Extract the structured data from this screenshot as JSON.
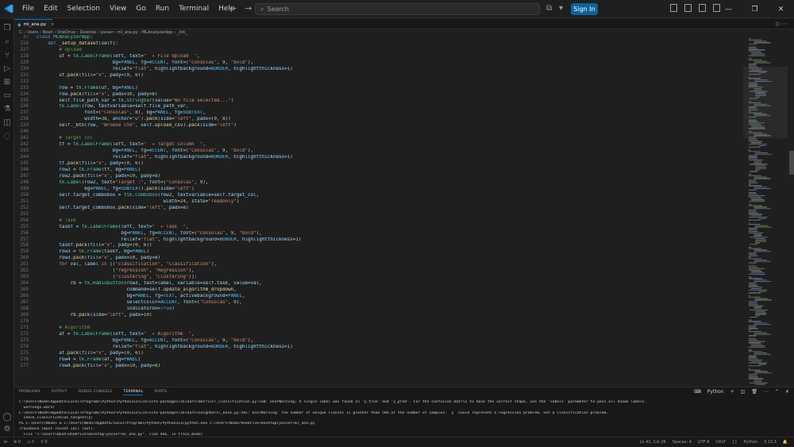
{
  "titlebar": {
    "menu": [
      "File",
      "Edit",
      "Selection",
      "View",
      "Go",
      "Run",
      "Terminal",
      "Help"
    ],
    "search_placeholder": "Search",
    "signin_label": "Sign In"
  },
  "tab": {
    "filename": "ml_ana.py",
    "close": "×"
  },
  "breadcrumb": [
    "C:",
    "Users",
    "Noah",
    "OneDrive",
    "Desktop",
    "yasser",
    "ml_ana.py",
    "MLAnalyzerApp",
    "_init_"
  ],
  "sticky_lines": [
    {
      "n": "37",
      "html": "<span class=\"kw\">class</span> <span class=\"cls\">MLAnalyzerApp</span>:"
    },
    {
      "n": "216",
      "html": "    <span class=\"kw\">def</span> <span class=\"fn\">_setup_dataset</span>(<span class=\"var\">self</span>):"
    }
  ],
  "code_lines": [
    {
      "n": "227",
      "html": "        <span class=\"cm\"># Upload</span>"
    },
    {
      "n": "228",
      "html": "        <span class=\"var\">uf</span> = <span class=\"cls\">tk</span>.<span class=\"cls\">LabelFrame</span>(<span class=\"var\">left</span>, <span class=\"var\">text</span>=<span class=\"str\">\"  ✦ File Upload  \"</span>,"
    },
    {
      "n": "229",
      "html": "                           <span class=\"var\">bg</span>=<span class=\"cst\">PANEL</span>, <span class=\"var\">fg</span>=<span class=\"cst\">ACCENT</span>, <span class=\"var\">font</span>=(<span class=\"str\">\"Consolas\"</span>, <span class=\"num\">9</span>, <span class=\"str\">\"bold\"</span>),"
    },
    {
      "n": "230",
      "html": "                           <span class=\"var\">relief</span>=<span class=\"str\">\"flat\"</span>, <span class=\"var\">highlightbackground</span>=<span class=\"cst\">BORDER</span>, <span class=\"var\">highlightthickness</span>=<span class=\"num\">1</span>)"
    },
    {
      "n": "231",
      "html": "        <span class=\"var\">uf</span>.<span class=\"fn\">pack</span>(<span class=\"var\">fill</span>=<span class=\"str\">\"x\"</span>, <span class=\"var\">pady</span>=(<span class=\"num\">0</span>, <span class=\"num\">6</span>))"
    },
    {
      "n": "232",
      "html": ""
    },
    {
      "n": "233",
      "html": "        <span class=\"var\">row</span> = <span class=\"cls\">tk</span>.<span class=\"cls\">Frame</span>(<span class=\"var\">uf</span>, <span class=\"var\">bg</span>=<span class=\"cst\">PANEL</span>)"
    },
    {
      "n": "234",
      "html": "        <span class=\"var\">row</span>.<span class=\"fn\">pack</span>(<span class=\"var\">fill</span>=<span class=\"str\">\"x\"</span>, <span class=\"var\">padx</span>=<span class=\"num\">10</span>, <span class=\"var\">pady</span>=<span class=\"num\">8</span>)"
    },
    {
      "n": "235",
      "html": "        <span class=\"var\">self</span>.<span class=\"var\">file_path_var</span> = <span class=\"cls\">tk</span>.<span class=\"cls\">StringVar</span>(<span class=\"var\">value</span>=<span class=\"str\">\"No file selected...\"</span>)"
    },
    {
      "n": "236",
      "html": "        <span class=\"cls\">tk</span>.<span class=\"cls\">Label</span>(<span class=\"var\">row</span>, <span class=\"var\">textvariable</span>=<span class=\"var\">self</span>.<span class=\"var\">file_path_var</span>,"
    },
    {
      "n": "237",
      "html": "                 <span class=\"var\">font</span>=(<span class=\"str\">\"Consolas\"</span>, <span class=\"num\">8</span>), <span class=\"var\">bg</span>=<span class=\"cst\">PANEL</span>, <span class=\"var\">fg</span>=<span class=\"cst\">SUBTEXT</span>,"
    },
    {
      "n": "238",
      "html": "                 <span class=\"var\">width</span>=<span class=\"num\">38</span>, <span class=\"var\">anchor</span>=<span class=\"str\">\"w\"</span>).<span class=\"fn\">pack</span>(<span class=\"var\">side</span>=<span class=\"str\">\"left\"</span>, <span class=\"var\">padx</span>=(<span class=\"num\">0</span>, <span class=\"num\">8</span>))"
    },
    {
      "n": "239",
      "html": "        <span class=\"var\">self</span>.<span class=\"fn\">_btn</span>(<span class=\"var\">row</span>, <span class=\"str\">\"Browse CSV\"</span>, <span class=\"var\">self</span>.<span class=\"fn\">upload_csv</span>).<span class=\"fn\">pack</span>(<span class=\"var\">side</span>=<span class=\"str\">\"left\"</span>)"
    },
    {
      "n": "240",
      "html": ""
    },
    {
      "n": "241",
      "html": "        <span class=\"cm\"># Target col</span>"
    },
    {
      "n": "242",
      "html": "        <span class=\"var\">tf</span> = <span class=\"cls\">tk</span>.<span class=\"cls\">LabelFrame</span>(<span class=\"var\">left</span>, <span class=\"var\">text</span>=<span class=\"str\">\"  ✦ Target Column  \"</span>,"
    },
    {
      "n": "243",
      "html": "                           <span class=\"var\">bg</span>=<span class=\"cst\">PANEL</span>, <span class=\"var\">fg</span>=<span class=\"cst\">ACCENT</span>, <span class=\"var\">font</span>=(<span class=\"str\">\"Consolas\"</span>, <span class=\"num\">9</span>, <span class=\"str\">\"bold\"</span>),"
    },
    {
      "n": "244",
      "html": "                           <span class=\"var\">relief</span>=<span class=\"str\">\"flat\"</span>, <span class=\"var\">highlightbackground</span>=<span class=\"cst\">BORDER</span>, <span class=\"var\">highlightthickness</span>=<span class=\"num\">1</span>)"
    },
    {
      "n": "245",
      "html": "        <span class=\"var\">tf</span>.<span class=\"fn\">pack</span>(<span class=\"var\">fill</span>=<span class=\"str\">\"x\"</span>, <span class=\"var\">pady</span>=(<span class=\"num\">0</span>, <span class=\"num\">6</span>))"
    },
    {
      "n": "246",
      "html": "        <span class=\"var\">row2</span> = <span class=\"cls\">tk</span>.<span class=\"cls\">Frame</span>(<span class=\"var\">tf</span>, <span class=\"var\">bg</span>=<span class=\"cst\">PANEL</span>)"
    },
    {
      "n": "247",
      "html": "        <span class=\"var\">row2</span>.<span class=\"fn\">pack</span>(<span class=\"var\">fill</span>=<span class=\"str\">\"x\"</span>, <span class=\"var\">padx</span>=<span class=\"num\">10</span>, <span class=\"var\">pady</span>=<span class=\"num\">8</span>)"
    },
    {
      "n": "248",
      "html": "        <span class=\"cls\">tk</span>.<span class=\"cls\">Label</span>(<span class=\"var\">row2</span>, <span class=\"var\">text</span>=<span class=\"str\">\"Target :\"</span>, <span class=\"var\">font</span>=(<span class=\"str\">\"Consolas\"</span>, <span class=\"num\">9</span>),"
    },
    {
      "n": "249",
      "html": "                 <span class=\"var\">bg</span>=<span class=\"cst\">PANEL</span>, <span class=\"var\">fg</span>=<span class=\"cst\">SUBTEXT</span>).<span class=\"fn\">pack</span>(<span class=\"var\">side</span>=<span class=\"str\">\"left\"</span>)"
    },
    {
      "n": "250",
      "html": "        <span class=\"var\">self</span>.<span class=\"var\">target_combobox</span> = <span class=\"cls\">ttk</span>.<span class=\"cls\">Combobox</span>(<span class=\"var\">row2</span>, <span class=\"var\">textvariable</span>=<span class=\"var\">self</span>.<span class=\"var\">target_col</span>,"
    },
    {
      "n": "251",
      "html": "                                             <span class=\"var\">width</span>=<span class=\"num\">24</span>, <span class=\"var\">state</span>=<span class=\"str\">\"readonly\"</span>)"
    },
    {
      "n": "252",
      "html": "        <span class=\"var\">self</span>.<span class=\"var\">target_combobox</span>.<span class=\"fn\">pack</span>(<span class=\"var\">side</span>=<span class=\"str\">\"left\"</span>, <span class=\"var\">padx</span>=<span class=\"num\">8</span>)"
    },
    {
      "n": "253",
      "html": ""
    },
    {
      "n": "254",
      "html": "        <span class=\"cm\"># Task</span>"
    },
    {
      "n": "255",
      "html": "        <span class=\"var\">taskf</span> = <span class=\"cls\">tk</span>.<span class=\"cls\">LabelFrame</span>(<span class=\"var\">left</span>, <span class=\"var\">text</span>=<span class=\"str\">\"  ✦ Task  \"</span>,"
    },
    {
      "n": "256",
      "html": "                              <span class=\"var\">bg</span>=<span class=\"cst\">PANEL</span>, <span class=\"var\">fg</span>=<span class=\"cst\">ACCENT</span>, <span class=\"var\">font</span>=(<span class=\"str\">\"Consolas\"</span>, <span class=\"num\">9</span>, <span class=\"str\">\"bold\"</span>),"
    },
    {
      "n": "257",
      "html": "                              <span class=\"var\">relief</span>=<span class=\"str\">\"flat\"</span>, <span class=\"var\">highlightbackground</span>=<span class=\"cst\">BORDER</span>, <span class=\"var\">highlightthickness</span>=<span class=\"num\">1</span>)"
    },
    {
      "n": "258",
      "html": "        <span class=\"var\">taskf</span>.<span class=\"fn\">pack</span>(<span class=\"var\">fill</span>=<span class=\"str\">\"x\"</span>, <span class=\"var\">pady</span>=(<span class=\"num\">0</span>, <span class=\"num\">6</span>))"
    },
    {
      "n": "259",
      "html": "        <span class=\"var\">row3</span> = <span class=\"cls\">tk</span>.<span class=\"cls\">Frame</span>(<span class=\"var\">taskf</span>, <span class=\"var\">bg</span>=<span class=\"cst\">PANEL</span>)"
    },
    {
      "n": "260",
      "html": "        <span class=\"var\">row3</span>.<span class=\"fn\">pack</span>(<span class=\"var\">fill</span>=<span class=\"str\">\"x\"</span>, <span class=\"var\">padx</span>=<span class=\"num\">10</span>, <span class=\"var\">pady</span>=<span class=\"num\">8</span>)"
    },
    {
      "n": "261",
      "html": "        <span class=\"kc\">for</span> <span class=\"var\">val</span>, <span class=\"var\">label</span> <span class=\"kc\">in</span> [(<span class=\"str\">\"classification\"</span>, <span class=\"str\">\"Classification\"</span>),"
    },
    {
      "n": "262",
      "html": "                           (<span class=\"str\">\"regression\"</span>, <span class=\"str\">\"Regression\"</span>),"
    },
    {
      "n": "263",
      "html": "                           (<span class=\"str\">\"clustering\"</span>, <span class=\"str\">\"Clustering\"</span>)]:"
    },
    {
      "n": "264",
      "html": "            <span class=\"var\">rb</span> = <span class=\"cls\">tk</span>.<span class=\"cls\">Radiobutton</span>(<span class=\"var\">row3</span>, <span class=\"var\">text</span>=<span class=\"var\">label</span>, <span class=\"var\">variable</span>=<span class=\"var\">self</span>.<span class=\"var\">task</span>, <span class=\"var\">value</span>=<span class=\"var\">val</span>,"
    },
    {
      "n": "265",
      "html": "                                <span class=\"var\">command</span>=<span class=\"var\">self</span>.<span class=\"fn\">update_algorithm_dropdown</span>,"
    },
    {
      "n": "266",
      "html": "                                <span class=\"var\">bg</span>=<span class=\"cst\">PANEL</span>, <span class=\"var\">fg</span>=<span class=\"cst\">TEXT</span>, <span class=\"var\">activebackground</span>=<span class=\"cst\">PANEL</span>,"
    },
    {
      "n": "267",
      "html": "                                <span class=\"var\">selectcolor</span>=<span class=\"cst\">ACCENT</span>, <span class=\"var\">font</span>=(<span class=\"str\">\"Consolas\"</span>, <span class=\"num\">9</span>),"
    },
    {
      "n": "268",
      "html": "                                <span class=\"var\">indicatoron</span>=<span class=\"kw\">True</span>)"
    },
    {
      "n": "269",
      "html": "            <span class=\"var\">rb</span>.<span class=\"fn\">pack</span>(<span class=\"var\">side</span>=<span class=\"str\">\"left\"</span>, <span class=\"var\">padx</span>=<span class=\"num\">10</span>)"
    },
    {
      "n": "270",
      "html": ""
    },
    {
      "n": "271",
      "html": "        <span class=\"cm\"># Algorithm</span>"
    },
    {
      "n": "272",
      "html": "        <span class=\"var\">af</span> = <span class=\"cls\">tk</span>.<span class=\"cls\">LabelFrame</span>(<span class=\"var\">left</span>, <span class=\"var\">text</span>=<span class=\"str\">\"  ✦ Algorithm  \"</span>,"
    },
    {
      "n": "273",
      "html": "                           <span class=\"var\">bg</span>=<span class=\"cst\">PANEL</span>, <span class=\"var\">fg</span>=<span class=\"cst\">ACCENT</span>, <span class=\"var\">font</span>=(<span class=\"str\">\"Consolas\"</span>, <span class=\"num\">9</span>, <span class=\"str\">\"bold\"</span>),"
    },
    {
      "n": "274",
      "html": "                           <span class=\"var\">relief</span>=<span class=\"str\">\"flat\"</span>, <span class=\"var\">highlightbackground</span>=<span class=\"cst\">BORDER</span>, <span class=\"var\">highlightthickness</span>=<span class=\"num\">1</span>)"
    },
    {
      "n": "275",
      "html": "        <span class=\"var\">af</span>.<span class=\"fn\">pack</span>(<span class=\"var\">fill</span>=<span class=\"str\">\"x\"</span>, <span class=\"var\">pady</span>=(<span class=\"num\">0</span>, <span class=\"num\">6</span>))"
    },
    {
      "n": "276",
      "html": "        <span class=\"var\">row4</span> = <span class=\"cls\">tk</span>.<span class=\"cls\">Frame</span>(<span class=\"var\">af</span>, <span class=\"var\">bg</span>=<span class=\"cst\">PANEL</span>)"
    },
    {
      "n": "277",
      "html": "        <span class=\"var\">row4</span>.<span class=\"fn\">pack</span>(<span class=\"var\">fill</span>=<span class=\"str\">\"x\"</span>, <span class=\"var\">padx</span>=<span class=\"num\">10</span>, <span class=\"var\">pady</span>=<span class=\"num\">8</span>)"
    }
  ],
  "panel": {
    "tabs": [
      "PROBLEMS",
      "OUTPUT",
      "DEBUG CONSOLE",
      "TERMINAL",
      "PORTS"
    ],
    "active_tab": "TERMINAL",
    "shell": "Python"
  },
  "terminal_lines": [
    "C:\\Users\\Noah\\AppData\\Local\\Programs\\Python\\Python313\\Lib\\site-packages\\sklearn\\metrics\\_classification.py:530: UserWarning: A single label was found in 'y_true' and 'y_pred'. For the confusion matrix to have the correct shape, use the 'labels' parameter to pass all known labels.",
    "  warnings.warn(",
    "C:\\Users\\Noah\\AppData\\Local\\Programs\\Python\\Python313\\Lib\\site-packages\\sklearn\\neighbors\\_base.py:501: UserWarning: The number of unique classes is greater than 50% of the number of samples. `y` could represent a regression problem, not a classification problem.",
    "  check_classification_targets(y)",
    "PS C:\\Users\\Noah> & C:/Users/Noah/AppData/Local/Programs/Python/Python313/python.exe c:/Users/Noah/OneDrive/Desktop/yasser/ml_ana.py",
    "Traceback (most recent call last):",
    "  File \"c:\\Users\\Noah\\OneDrive\\Desktop\\yasser\\ml_ana.py\", line 466, in train_model"
  ],
  "statusbar": {
    "errors": "⊗ 0",
    "warnings": "⚠ 0",
    "ports": "⚲ 0",
    "position": "Ln 41, Col 26",
    "spaces": "Spaces: 4",
    "encoding": "UTF-8",
    "eol": "CRLF",
    "braces": "{}",
    "language": "Python",
    "version": "3.13.3"
  },
  "colors": {
    "accent": "#0078d4",
    "signin": "#0e639c",
    "background": "#1f1f1f"
  }
}
